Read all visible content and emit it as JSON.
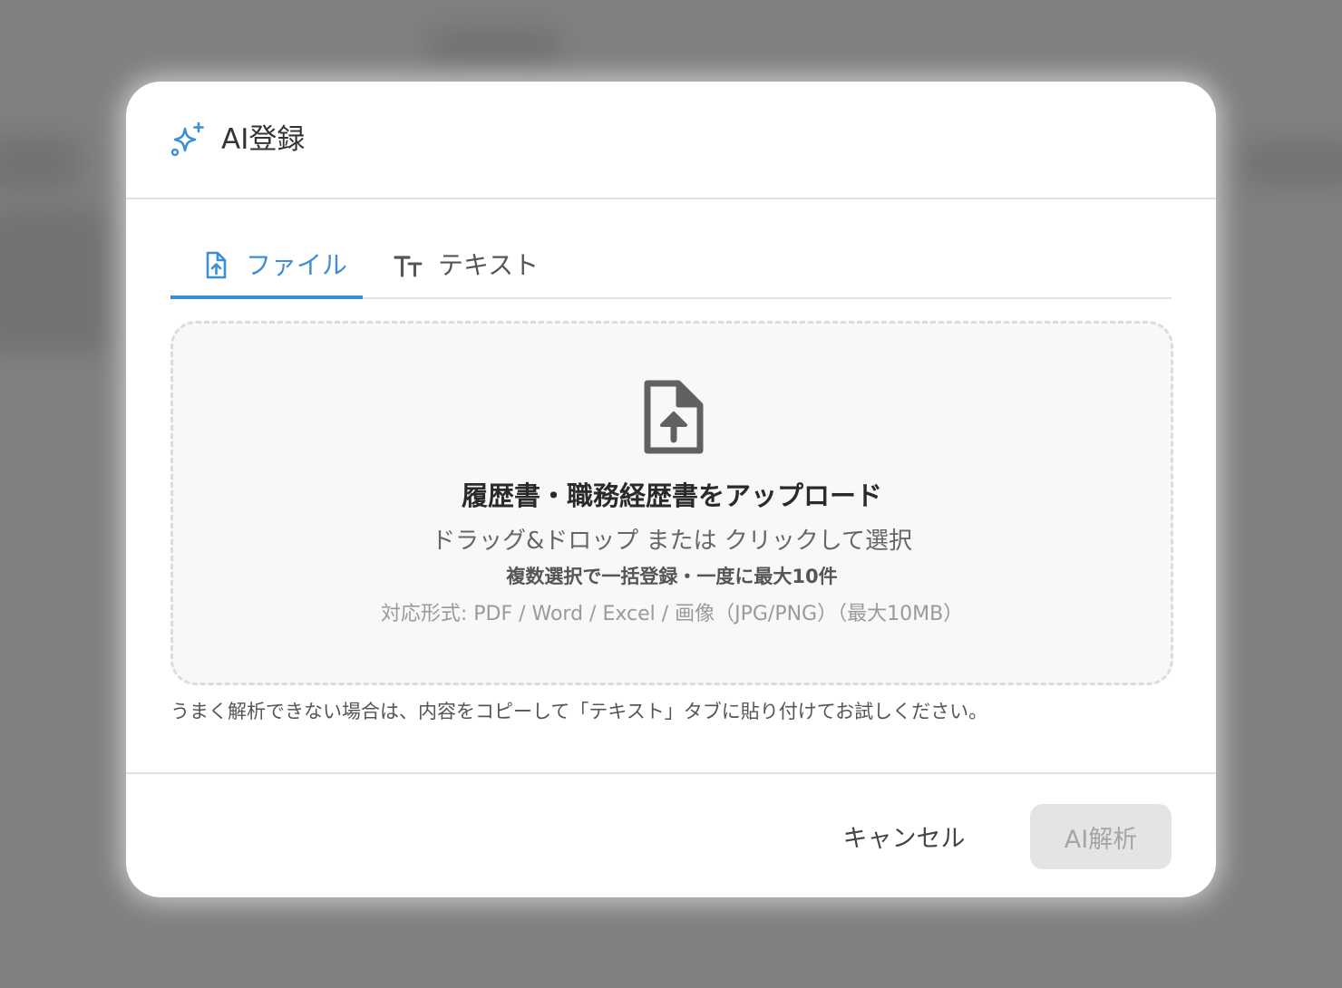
{
  "dialog": {
    "title": "AI登録",
    "header_icon": "sparkles-icon"
  },
  "tabs": [
    {
      "label": "ファイル",
      "icon": "file-upload-icon",
      "active": true
    },
    {
      "label": "テキスト",
      "icon": "text-size-icon",
      "active": false
    }
  ],
  "dropzone": {
    "icon": "file-upload-icon",
    "title": "履歴書・職務経歴書をアップロード",
    "subtitle": "ドラッグ&ドロップ または クリックして選択",
    "bulk_note": "複数選択で一括登録・一度に最大10件",
    "formats": "対応形式: PDF / Word / Excel / 画像（JPG/PNG）（最大10MB）"
  },
  "hint": "うまく解析できない場合は、内容をコピーして「テキスト」タブに貼り付けてお試しください。",
  "footer": {
    "cancel_label": "キャンセル",
    "analyze_label": "AI解析",
    "analyze_disabled": true
  },
  "colors": {
    "accent": "#3b8fd6",
    "overlay": "#808080",
    "disabled_button_bg": "#e4e4e4",
    "disabled_button_text": "#a5a5a5"
  }
}
